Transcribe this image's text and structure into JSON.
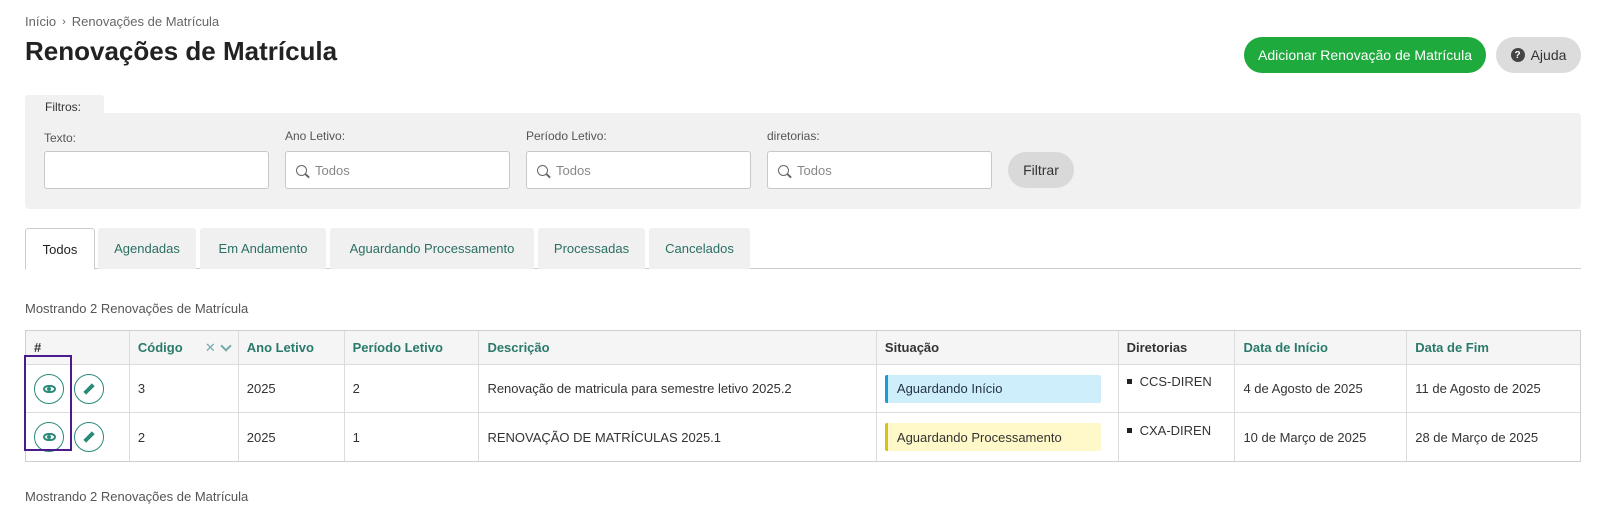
{
  "breadcrumb": {
    "home": "Início",
    "current": "Renovações de Matrícula"
  },
  "page_title": "Renovações de Matrícula",
  "header": {
    "add_button": "Adicionar Renovação de Matrícula",
    "help_button": "Ajuda"
  },
  "filters": {
    "tab_label": "Filtros:",
    "texto_label": "Texto:",
    "texto_value": "",
    "ano_label": "Ano Letivo:",
    "ano_placeholder": "Todos",
    "periodo_label": "Período Letivo:",
    "periodo_placeholder": "Todos",
    "diretorias_label": "diretorias:",
    "diretorias_placeholder": "Todos",
    "filter_button": "Filtrar"
  },
  "tabs": [
    {
      "label": "Todos",
      "active": true
    },
    {
      "label": "Agendadas"
    },
    {
      "label": "Em Andamento"
    },
    {
      "label": "Aguardando Processamento"
    },
    {
      "label": "Processadas"
    },
    {
      "label": "Cancelados"
    }
  ],
  "showing_text": "Mostrando 2 Renovações de Matrícula",
  "table": {
    "headers": [
      "#",
      "Código",
      "Ano Letivo",
      "Período Letivo",
      "Descrição",
      "Situação",
      "Diretorias",
      "Data de Início",
      "Data de Fim"
    ],
    "sort_clear": "✕",
    "rows": [
      {
        "codigo": "3",
        "ano": "2025",
        "periodo": "2",
        "descricao": "Renovação de matricula para semestre letivo 2025.2",
        "situacao": "Aguardando Início",
        "diretoria": "CCS-DIREN",
        "inicio": "4 de Agosto de 2025",
        "fim": "11 de Agosto de 2025"
      },
      {
        "codigo": "2",
        "ano": "2025",
        "periodo": "1",
        "descricao": "RENOVAÇÃO DE MATRÍCULAS 2025.1",
        "situacao": "Aguardando Processamento",
        "diretoria": "CXA-DIREN",
        "inicio": "10 de Março de 2025",
        "fim": "28 de Março de 2025"
      }
    ]
  },
  "colors": {
    "primary": "#1eaa3c",
    "link": "#2a7a6c",
    "status_blue": "#cfeefc",
    "status_yellow": "#fff8c8",
    "highlight": "#4b1a8c"
  }
}
